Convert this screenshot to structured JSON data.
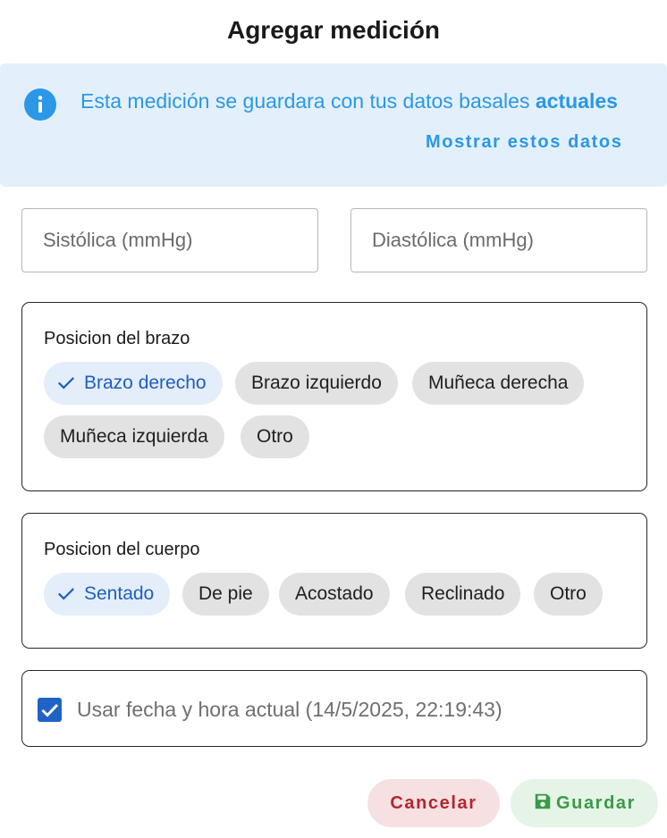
{
  "dialog": {
    "title": "Agregar medición"
  },
  "info": {
    "icon": "info-icon",
    "text": "Esta medición se guardara con tus datos basales ",
    "text_bold": "actuales",
    "link_label": "Mostrar estos datos",
    "color": "#2b97e6"
  },
  "fields": {
    "systolic_placeholder": "Sistólica (mmHg)",
    "systolic_value": "",
    "diastolic_placeholder": "Diastólica (mmHg)",
    "diastolic_value": ""
  },
  "arm_position": {
    "label": "Posicion del brazo",
    "selected": "Brazo derecho",
    "options": [
      "Brazo derecho",
      "Brazo izquierdo",
      "Muñeca derecha",
      "Muñeca izquierda",
      "Otro"
    ]
  },
  "body_position": {
    "label": "Posicion del cuerpo",
    "selected": "Sentado",
    "options": [
      "Sentado",
      "De pie",
      "Acostado",
      "Reclinado",
      "Otro"
    ]
  },
  "datetime": {
    "checked": true,
    "label": "Usar fecha y hora actual (14/5/2025, 22:19:43)"
  },
  "actions": {
    "cancel_label": "Cancelar",
    "save_label": "Guardar",
    "save_icon": "save-icon",
    "cancel_color": "#b3262e",
    "save_color": "#3a9a47"
  },
  "colors": {
    "accent": "#1f63c5",
    "info_bg": "#e3f0fb"
  }
}
